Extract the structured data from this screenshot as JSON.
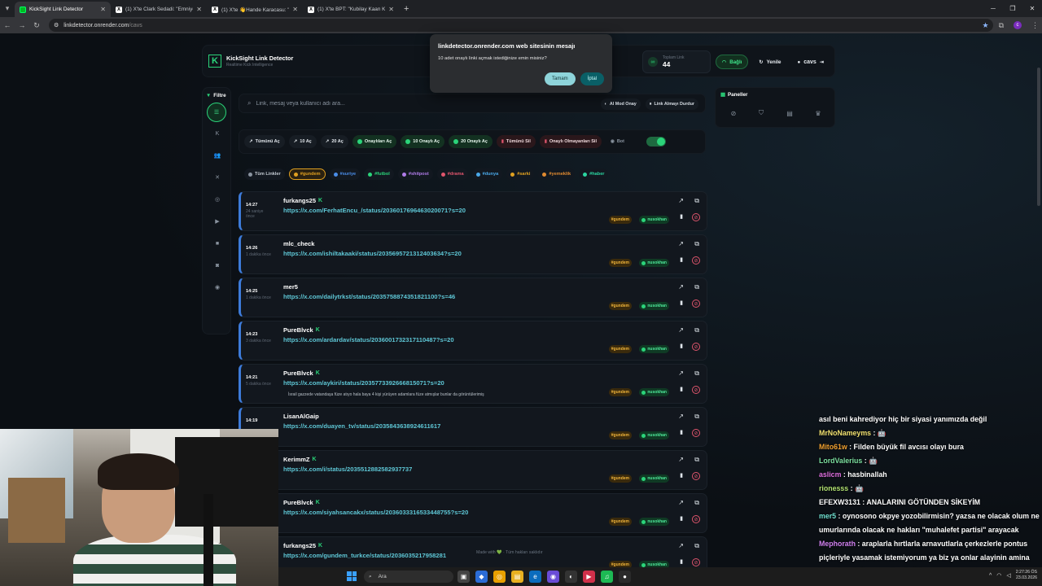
{
  "browser": {
    "tabs": [
      {
        "title": "KickSight Link Detector",
        "active": true
      },
      {
        "title": "(1) X'te Clark Sedadi: \"Emniyet",
        "active": false
      },
      {
        "title": "(1) X'te 👋Hande Karacasu: \"N",
        "active": false
      },
      {
        "title": "(1) X'te BPT: \"Kubilay Kaan Kur",
        "active": false
      }
    ],
    "url_host": "linkdetector.onrender.com",
    "url_path": "/cavs"
  },
  "header": {
    "app_name": "KickSight Link Detector",
    "tagline": "Realtime Kick Intelligence",
    "total_label": "Toplam Link",
    "total_value": "44",
    "connected_label": "Bağlı",
    "refresh_label": "Yenile",
    "username": "cavs"
  },
  "dialog": {
    "title": "linkdetector.onrender.com web sitesinin mesajı",
    "message": "10 adet onaylı linki açmak istediğinize emin misiniz?",
    "ok_label": "Tamam",
    "cancel_label": "İptal"
  },
  "sidebar": {
    "title": "Filtre"
  },
  "search": {
    "placeholder": "Link, mesaj veya kullanıcı adı ara...",
    "ai_mode_label": "AI Mod Onay",
    "pause_label": "Link Almayı Durdur"
  },
  "actions": {
    "open_all": "Tümünü Aç",
    "open_10": "10 Aç",
    "open_20": "20 Aç",
    "open_approved": "Onaylıları Aç",
    "open_10_approved": "10 Onaylı Aç",
    "open_20_approved": "20 Onaylı Aç",
    "delete_all": "Tümünü Sil",
    "delete_unapproved": "Onaylı Olmayanları Sil",
    "bot_label": "Bot"
  },
  "tags": [
    {
      "label": "Tüm Linkler",
      "color": "#8a94a0"
    },
    {
      "label": "#gundem",
      "color": "#e0a020"
    },
    {
      "label": "#suriye",
      "color": "#4a8de8"
    },
    {
      "label": "#futbol",
      "color": "#2bd47a"
    },
    {
      "label": "#shitpost",
      "color": "#b07be8"
    },
    {
      "label": "#drama",
      "color": "#e0556d"
    },
    {
      "label": "#dunya",
      "color": "#4aa8e8"
    },
    {
      "label": "#sarki",
      "color": "#e0a020"
    },
    {
      "label": "#yemeklik",
      "color": "#e08a30"
    },
    {
      "label": "#haber",
      "color": "#2bd4a0"
    }
  ],
  "panels": {
    "title": "Paneller"
  },
  "feed": [
    {
      "time": "14:27",
      "ago": "24 saniye önce",
      "user": "furkangs25",
      "kick": true,
      "link": "https://x.com/FerhatEncu_/status/2036017696463020071?s=20",
      "msg": "",
      "tag": "#gundem",
      "status": "nusokhan"
    },
    {
      "time": "14:26",
      "ago": "1 dakika önce",
      "user": "mlc_check",
      "kick": false,
      "link": "https://x.com/ishiltakaaki/status/2035695721312403634?s=20",
      "msg": "",
      "tag": "#gundem",
      "status": "nusokhan"
    },
    {
      "time": "14:25",
      "ago": "1 dakika önce",
      "user": "mer5",
      "kick": false,
      "link": "https://x.com/dailytrkst/status/2035758874351821100?s=46",
      "msg": "",
      "tag": "#gundem",
      "status": "nusokhan"
    },
    {
      "time": "14:23",
      "ago": "3 dakika önce",
      "user": "PureBlvck",
      "kick": true,
      "link": "https://x.com/ardardav/status/2036001732317110487?s=20",
      "msg": "",
      "tag": "#gundem",
      "status": "nusokhan"
    },
    {
      "time": "14:21",
      "ago": "5 dakika önce",
      "user": "PureBlvck",
      "kick": true,
      "link": "https://x.com/aykiri/status/2035773392666815071?s=20",
      "msg": "İsrail gazzede vatandaşa füze atıyo hala baya 4 kişi yürüyen adamlara füze atmışlar bunlar da görüntülerimiş",
      "tag": "#gundem",
      "status": "nusokhan"
    },
    {
      "time": "14:19",
      "ago": "",
      "user": "LisanAlGaip",
      "kick": false,
      "link": "https://x.com/duayen_tv/status/2035843638924611617",
      "msg": "",
      "tag": "#gundem",
      "status": "nusokhan"
    },
    {
      "time": "",
      "ago": "",
      "user": "KerimmZ",
      "kick": true,
      "link": "https://x.com/i/status/2035512882582937737",
      "msg": "",
      "tag": "#gundem",
      "status": "nusokhan"
    },
    {
      "time": "",
      "ago": "",
      "user": "PureBlvck",
      "kick": true,
      "link": "https://x.com/siyahsancakx/status/2036033316533448755?s=20",
      "msg": "",
      "tag": "#gundem",
      "status": "nusokhan"
    },
    {
      "time": "",
      "ago": "",
      "user": "furkangs25",
      "kick": true,
      "link": "https://x.com/gundem_turkce/status/2036035217958281",
      "msg": "",
      "tag": "#gundem",
      "status": "nusokhan"
    }
  ],
  "footer_note": "Made with 💚 · Tüm hakları saklıdır",
  "chat": [
    {
      "user": "",
      "color": "#ffffff",
      "text": "asıl beni kahrediyor hiç bir siyasi yanımızda değil"
    },
    {
      "user": "MrNoNameyms",
      "color": "#f0e070",
      "text": " : 🤖"
    },
    {
      "user": "Mito61w",
      "color": "#f0a030",
      "text": " : Filden büyük fil avcısı olayı bura"
    },
    {
      "user": "LordValerius",
      "color": "#7ce0a0",
      "text": " : 🤖"
    },
    {
      "user": "aslicm",
      "color": "#e070e0",
      "text": " : hasbinallah"
    },
    {
      "user": "rionesss",
      "color": "#b0e070",
      "text": " : 🤖"
    },
    {
      "user": "EFEXW3131",
      "color": "#ffffff",
      "text": " : ANALARINI GÖTÜNDEN SİKEYİM"
    },
    {
      "user": "mer5",
      "color": "#70e0d0",
      "text": " : oynosono okpye yozobilirmisin? yazsa ne olacak olum ne umurlarında olacak ne hakları \"muhalefet partisi\" arayacak"
    },
    {
      "user": "Mephorath",
      "color": "#d080f0",
      "text": " : araplarla hırtlarla arnavutlarla çerkezlerle pontus piçleriyle yasamak istemiyorum ya biz ya onlar alayinin amina koyayim etnik paarazit azinliklar"
    }
  ],
  "taskbar": {
    "search_label": "Ara",
    "time": "2:27:26 ÖS",
    "date": "23.03.2026"
  },
  "colors": {
    "accent": "#2bd47a",
    "link": "#5ec7d6",
    "danger": "#e0556d",
    "tag_gold": "#f0b43a"
  }
}
